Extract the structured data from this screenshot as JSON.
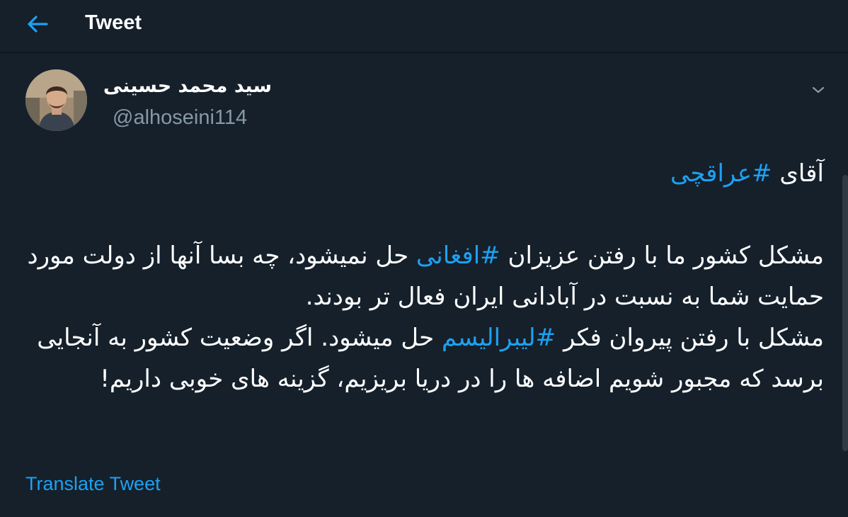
{
  "header": {
    "title": "Tweet",
    "back_icon": "arrow-left-icon"
  },
  "tweet": {
    "author": {
      "display_name": "سید محمد حسینی",
      "handle": "@alhoseini114"
    },
    "lines": {
      "line1_pre": "آقای ",
      "line1_tag": "#عراقچی",
      "p2_a": "مشکل کشور ما با رفتن عزیزان ",
      "p2_tag": "#افغانی",
      "p2_b": " حل نمیشود، چه بسا آنها از دولت مورد حمایت شما به نسبت در آبادانی ایران فعال تر بودند.",
      "p3_a": "مشکل با رفتن پیروان فکر ",
      "p3_tag": "#لیبرالیسم",
      "p3_b": " حل میشود. اگر وضعیت کشور به آنجایی برسد که مجبور شویم اضافه ها را در دریا بریزیم، گزینه های خوبی داریم!"
    },
    "translate_label": "Translate Tweet"
  },
  "colors": {
    "background": "#15202b",
    "accent": "#1da1f2",
    "text": "#ffffff",
    "secondary_text": "#8899a6"
  }
}
